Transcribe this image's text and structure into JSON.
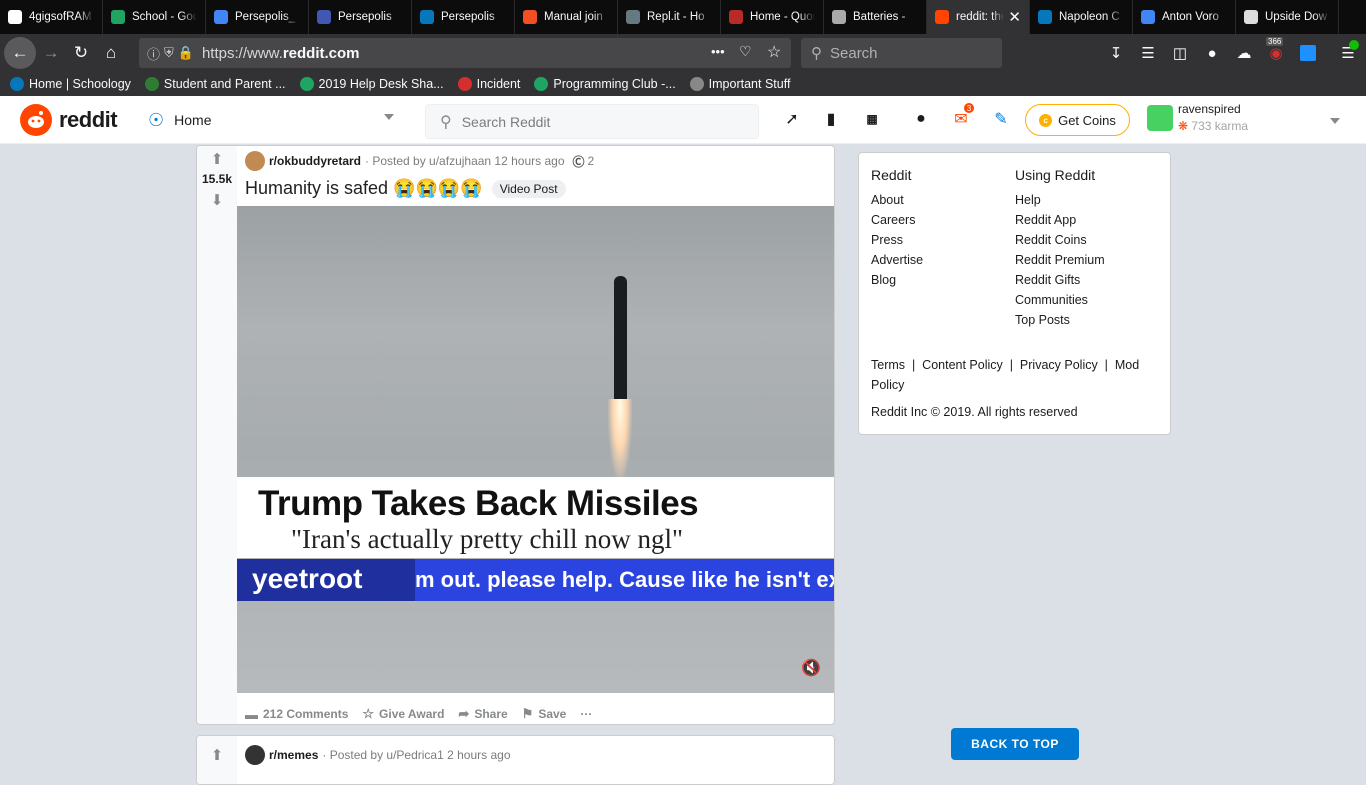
{
  "browser": {
    "tabs": [
      {
        "title": "4gigsofRAM",
        "icon": "github-icon",
        "color": "#ffffff"
      },
      {
        "title": "School - Google Drive",
        "icon": "drive-icon",
        "color": "#1fa463"
      },
      {
        "title": "Persepolis_",
        "icon": "docs-icon",
        "color": "#4285f4"
      },
      {
        "title": "Persepolis",
        "icon": "quizlet-icon",
        "color": "#4257b2"
      },
      {
        "title": "Persepolis",
        "icon": "schoology-icon",
        "color": "#0677ba"
      },
      {
        "title": "Manual join",
        "icon": "microsoft-icon",
        "color": "#f25022"
      },
      {
        "title": "Repl.it - Ho",
        "icon": "replit-icon",
        "color": "#667881"
      },
      {
        "title": "Home - Quora",
        "icon": "quora-icon",
        "color": "#b92b27"
      },
      {
        "title": "Batteries -",
        "icon": "apple-icon",
        "color": "#aaaaaa"
      },
      {
        "title": "reddit: the front page",
        "icon": "reddit-icon",
        "color": "#ff4500",
        "active": true
      },
      {
        "title": "Napoleon C",
        "icon": "schoology-icon",
        "color": "#0677ba"
      },
      {
        "title": "Anton Voro",
        "icon": "docs-icon",
        "color": "#4285f4"
      },
      {
        "title": "Upside Dow",
        "icon": "doc-icon",
        "color": "#dddddd"
      }
    ],
    "url_prefix": "https://www.",
    "url_host": "reddit.com",
    "search_placeholder": "Search",
    "badge_count": "366",
    "bookmarks": [
      {
        "label": "Home | Schoology",
        "icon": "schoology-icon",
        "color": "#0677ba"
      },
      {
        "label": "Student and Parent ...",
        "icon": "p-icon",
        "color": "#2e7d32"
      },
      {
        "label": "2019 Help Desk Sha...",
        "icon": "drive-icon",
        "color": "#1fa463"
      },
      {
        "label": "Incident",
        "icon": "servicenow-icon",
        "color": "#d32f2f"
      },
      {
        "label": "Programming Club -...",
        "icon": "drive-icon",
        "color": "#1fa463"
      },
      {
        "label": "Important Stuff",
        "icon": "folder-icon",
        "color": "#888888"
      }
    ]
  },
  "reddit": {
    "logo_text": "reddit",
    "home_label": "Home",
    "search_placeholder": "Search Reddit",
    "mail_count": "3",
    "coins_label": "Get Coins",
    "username": "ravenspired",
    "karma": "733 karma"
  },
  "posts": [
    {
      "subreddit": "r/okbuddyretard",
      "posted_by": "· Posted by u/afzujhaan 12 hours ago",
      "award_count": "2",
      "score": "15.5k",
      "title": "Humanity is safed 😭😭😭😭",
      "flair": "Video Post",
      "video": {
        "headline": "Trump Takes Back Missiles",
        "subheadline": "\"Iran's actually pretty chill now ngl\"",
        "ticker_name": "yeetroot",
        "ticker_msg": "m out. please help. Cause like he isn't ex"
      },
      "actions": {
        "comments": "212 Comments",
        "award": "Give Award",
        "share": "Share",
        "save": "Save",
        "more": "···"
      }
    },
    {
      "subreddit": "r/memes",
      "posted_by": "· Posted by u/Pedrica1 2 hours ago"
    }
  ],
  "sidebar": {
    "col1_title": "Reddit",
    "col1_links": [
      "About",
      "Careers",
      "Press",
      "Advertise",
      "Blog"
    ],
    "col2_title": "Using Reddit",
    "col2_links": [
      "Help",
      "Reddit App",
      "Reddit Coins",
      "Reddit Premium",
      "Reddit Gifts",
      "Communities",
      "Top Posts"
    ],
    "legal": [
      "Terms",
      "Content Policy",
      "Privacy Policy",
      "Mod Policy"
    ],
    "copyright": "Reddit Inc © 2019. All rights reserved"
  },
  "back_to_top": "BACK TO TOP",
  "colors": {
    "reddit_orange": "#ff4500",
    "blue": "#0079d3",
    "coin_gold": "#ffb000"
  }
}
